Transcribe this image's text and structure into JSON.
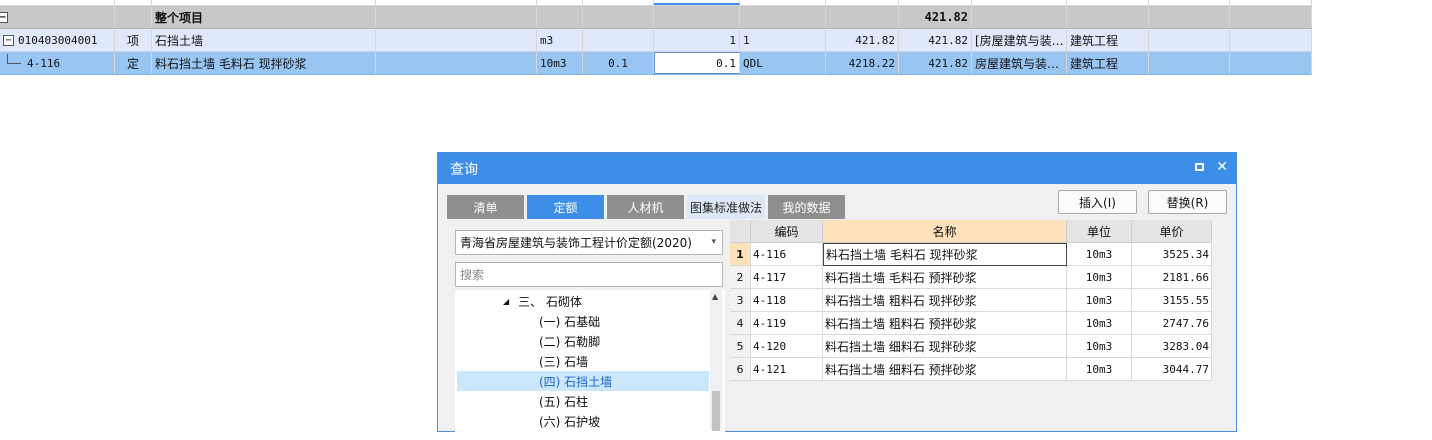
{
  "grid": {
    "total_row": {
      "label": "整个项目",
      "value": "421.82"
    },
    "item_row": {
      "code": "010403004001",
      "type": "项",
      "name": "石挡土墙",
      "unit": "m3",
      "qty": "1",
      "qty_expr": "1",
      "price": "421.82",
      "total": "421.82",
      "spec": "[房屋建筑与装…",
      "category": "建筑工程"
    },
    "quota_row": {
      "code": "4-116",
      "type": "定",
      "name": "料石挡土墙 毛料石 现拌砂浆",
      "unit": "10m3",
      "coef": "0.1",
      "qty": "0.1",
      "qty_expr": "QDL",
      "price": "4218.22",
      "total": "421.82",
      "spec": "房屋建筑与装…",
      "category": "建筑工程"
    }
  },
  "dialog": {
    "title": "查询",
    "tabs": [
      {
        "label": "清单"
      },
      {
        "label": "定额"
      },
      {
        "label": "人材机"
      },
      {
        "label": "图集标准做法"
      },
      {
        "label": "我的数据"
      }
    ],
    "buttons": {
      "insert": "插入(I)",
      "replace": "替换(R)"
    },
    "select_value": "青海省房屋建筑与装饰工程计价定额(2020)",
    "search_placeholder": "搜索",
    "tree": [
      {
        "label": "三、 石砌体"
      },
      {
        "label": "(一) 石基础"
      },
      {
        "label": "(二) 石勒脚"
      },
      {
        "label": "(三) 石墙"
      },
      {
        "label": "(四) 石挡土墙"
      },
      {
        "label": "(五) 石柱"
      },
      {
        "label": "(六) 石护坡"
      }
    ],
    "table": {
      "headers": {
        "code": "编码",
        "name": "名称",
        "unit": "单位",
        "price": "单价"
      },
      "rows": [
        {
          "idx": "1",
          "code": "4-116",
          "name": "料石挡土墙 毛料石 现拌砂浆",
          "unit": "10m3",
          "price": "3525.34"
        },
        {
          "idx": "2",
          "code": "4-117",
          "name": "料石挡土墙 毛料石 预拌砂浆",
          "unit": "10m3",
          "price": "2181.66"
        },
        {
          "idx": "3",
          "code": "4-118",
          "name": "料石挡土墙 粗料石 现拌砂浆",
          "unit": "10m3",
          "price": "3155.55"
        },
        {
          "idx": "4",
          "code": "4-119",
          "name": "料石挡土墙 粗料石 预拌砂浆",
          "unit": "10m3",
          "price": "2747.76"
        },
        {
          "idx": "5",
          "code": "4-120",
          "name": "料石挡土墙 细料石 现拌砂浆",
          "unit": "10m3",
          "price": "3283.04"
        },
        {
          "idx": "6",
          "code": "4-121",
          "name": "料石挡土墙 细料石 预拌砂浆",
          "unit": "10m3",
          "price": "3044.77"
        }
      ]
    }
  }
}
